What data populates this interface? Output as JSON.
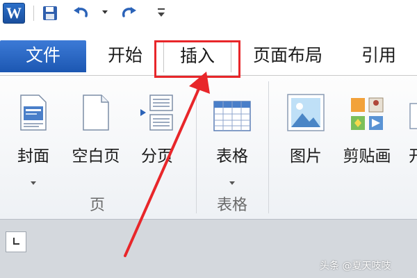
{
  "quick_access": {
    "logo_letter": "W",
    "icons": [
      "save-icon",
      "undo-icon",
      "redo-icon",
      "customize-icon"
    ]
  },
  "tabs": [
    {
      "label": "文件",
      "active": false
    },
    {
      "label": "开始",
      "active": false
    },
    {
      "label": "插入",
      "active": true
    },
    {
      "label": "页面布局",
      "active": false
    },
    {
      "label": "引用",
      "active": false
    }
  ],
  "ribbon": {
    "buttons": {
      "cover": "封面",
      "blank_page": "空白页",
      "page_break": "分页",
      "table": "表格",
      "picture": "图片",
      "clip_art": "剪贴画",
      "cutoff": "开"
    },
    "groups": {
      "pages": "页",
      "tables": "表格"
    }
  },
  "watermark": "头条 @夏天吱吱",
  "colors": {
    "file_tab": "#1c57b2",
    "highlight": "#e8262a"
  }
}
